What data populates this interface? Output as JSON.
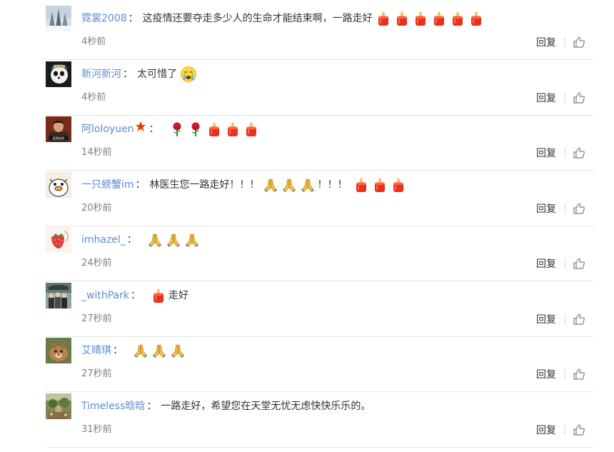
{
  "comments": [
    {
      "username": "霓裳2008",
      "text": "这疫情还要夺走多少人的生命才能结束啊，一路走好",
      "emojis_after": [
        "candle",
        "candle",
        "candle",
        "candle",
        "candle",
        "candle"
      ],
      "time": "4秒前",
      "reply_label": "回复",
      "avatar": "snowy-forest"
    },
    {
      "username": "新河新河",
      "text": "太可惜了",
      "emojis_after": [
        "crying-face"
      ],
      "time": "4秒前",
      "reply_label": "回复",
      "avatar": "panda-girl"
    },
    {
      "username": "阿loloyuen",
      "badge": "red-star",
      "text": "",
      "emojis_after": [
        "rose",
        "rose",
        "candle",
        "candle",
        "candle"
      ],
      "time": "14秒前",
      "reply_label": "回复",
      "avatar": "portrait-red"
    },
    {
      "username": "一只螃蟹im",
      "text": "林医生您一路走好！！！",
      "emojis_after": [
        "pray",
        "pray",
        "pray"
      ],
      "text_after": "！！！",
      "emojis_end": [
        "candle",
        "candle",
        "candle"
      ],
      "time": "20秒前",
      "reply_label": "回复",
      "avatar": "cartoon-duck"
    },
    {
      "username": "imhazel_",
      "text": "",
      "emojis_after": [
        "pray",
        "pray",
        "pray"
      ],
      "time": "24秒前",
      "reply_label": "回复",
      "avatar": "strawberry"
    },
    {
      "username": "_withPark",
      "text": "",
      "emojis_after": [
        "candle"
      ],
      "text_after": "走好",
      "time": "27秒前",
      "reply_label": "回复",
      "avatar": "group-photo"
    },
    {
      "username": "艾晴琪",
      "text": "",
      "emojis_after": [
        "pray",
        "pray",
        "pray"
      ],
      "time": "27秒前",
      "reply_label": "回复",
      "avatar": "brown-animal"
    },
    {
      "username": "Timeless晗晗",
      "text": "一路走好，希望您在天堂无忧无虑快快乐乐的。",
      "emojis_after": [],
      "time": "31秒前",
      "reply_label": "回复",
      "avatar": "garden-photo"
    }
  ],
  "colors": {
    "username": "#5b8bd0",
    "text": "#333333",
    "time": "#808080",
    "divider": "#e6e6e6"
  },
  "icons": {
    "like": "thumbs-up-icon",
    "candle": "candle-icon",
    "rose": "rose-icon",
    "pray": "pray-icon",
    "crying-face": "crying-face-icon",
    "red-star": "star-badge-icon"
  }
}
